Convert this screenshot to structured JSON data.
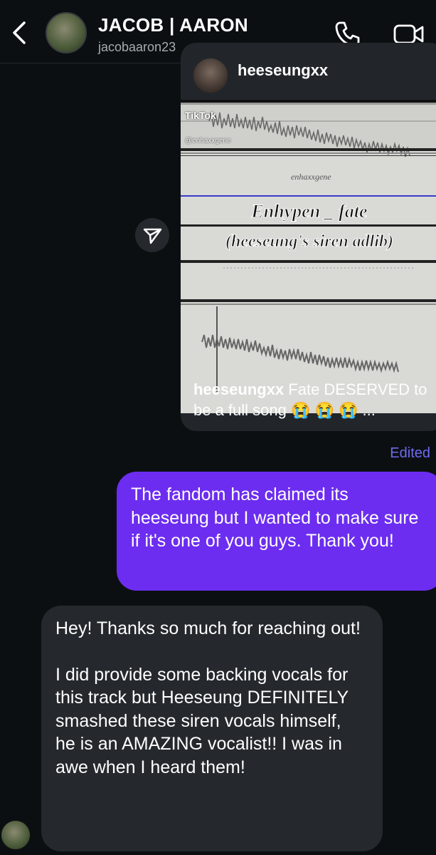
{
  "header": {
    "title": "JACOB | AARON",
    "subtitle": "jacobaaron23",
    "icons": [
      "back-chevron-icon",
      "phone-icon",
      "video-camera-icon"
    ]
  },
  "shared_post": {
    "username": "heeseungxx",
    "tiktok_label": "TikTok",
    "tiktok_handle": "@enhaxxgene",
    "watermark": "enhaxxgene",
    "overlay_line1": "Enhypen _ fate",
    "overlay_line2": "(heeseung's siren adlib)",
    "caption_user": "heeseungxx",
    "caption_text": " Fate DESERVED to be a full song 😭 😭 😭 ..."
  },
  "edited_label": "Edited",
  "messages": {
    "outgoing": "The fandom has claimed its heeseung but I wanted to make sure if it's one of you guys. Thank you!",
    "incoming_p1": "Hey! Thanks so much for reaching out!",
    "incoming_p2": "I did provide some backing vocals for this track but Heeseung DEFINITELY smashed these siren vocals himself, he is an AMAZING vocalist!! I was in awe when I heard them!"
  },
  "colors": {
    "background": "#0c0f12",
    "outgoing_bubble": "#6c2df0",
    "incoming_bubble": "#25292d",
    "edited": "#6e6af0"
  }
}
